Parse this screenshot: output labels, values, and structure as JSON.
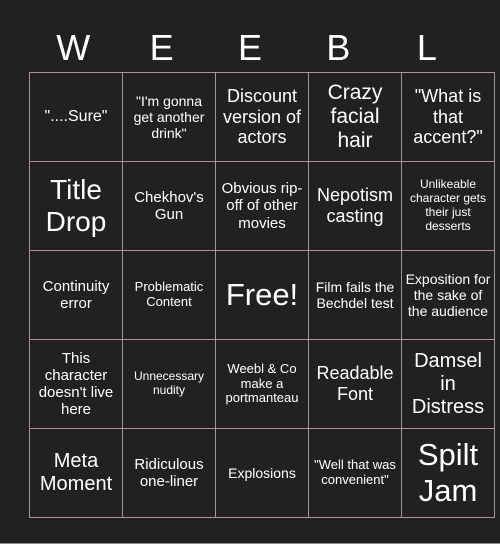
{
  "header": {
    "letters": [
      "W",
      "E",
      "E",
      "B",
      "L"
    ]
  },
  "board": {
    "rows": [
      [
        "\"....Sure\"",
        "\"I'm gonna get another drink\"",
        "Discount version of actors",
        "Crazy facial hair",
        "\"What is that accent?\""
      ],
      [
        "Title Drop",
        "Chekhov's Gun",
        "Obvious rip-off of other movies",
        "Nepotism casting",
        "Unlikeable character gets their just desserts"
      ],
      [
        "Continuity error",
        "Problematic Content",
        "Free!",
        "Film fails the Bechdel test",
        "Exposition for the sake of the audience"
      ],
      [
        "This character doesn't live here",
        "Unnecessary nudity",
        "Weebl & Co make a portmanteau",
        "Readable Font",
        "Damsel in Distress"
      ],
      [
        "Meta Moment",
        "Ridiculous one-liner",
        "Explosions",
        "\"Well that was convenient\"",
        "Spilt Jam"
      ]
    ]
  },
  "colors": {
    "background": "#212121",
    "border": "#b09090",
    "text": "#ffffff"
  }
}
